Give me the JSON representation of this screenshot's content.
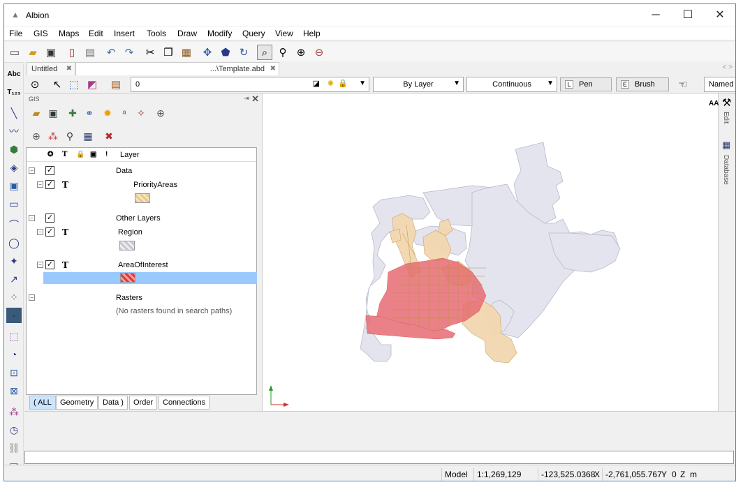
{
  "app": {
    "title": "Albion"
  },
  "window": {
    "minimize": "─",
    "maximize": "☐",
    "close": "✕"
  },
  "menu": [
    "File",
    "GIS",
    "Maps",
    "Edit",
    "Insert",
    "Tools",
    "Draw",
    "Modify",
    "Query",
    "View",
    "Help"
  ],
  "doc_tabs": [
    {
      "label": "Untitled"
    },
    {
      "label": "...\\Template.abd"
    }
  ],
  "tab_close": "✖",
  "tab_nav": "< >",
  "props": {
    "layer_value": "0",
    "linetype_color": "By Layer",
    "linetype": "Continuous",
    "pen_key": "L",
    "pen_label": "Pen",
    "brush_key": "E",
    "brush_label": "Brush",
    "named_style": "Named S"
  },
  "panel": {
    "title": "GIS",
    "pin": "⇥",
    "close": "✕"
  },
  "layer_header": {
    "c1": "✪",
    "c2": "T",
    "c3": "🔒",
    "c4": "▣",
    "c5": "!",
    "layer": "Layer"
  },
  "layers": {
    "data": "Data",
    "priority": "PriorityAreas",
    "other": "Other Layers",
    "region": "Region",
    "aoi": "AreaOfInterest",
    "rasters": "Rasters",
    "no_rasters": "(No rasters found in search paths)",
    "t": "T",
    "check": "✓",
    "minus": "−"
  },
  "bottom_tabs": [
    "( ALL",
    "Geometry",
    "Data )",
    "Order",
    "Connections"
  ],
  "right_dock": {
    "font_icon": "AA",
    "edit": "Edit",
    "database": "Database"
  },
  "status": {
    "model": "Model",
    "scale": "1:1,269,129",
    "x": "-123,525.0368",
    "x_label": "X",
    "y": "-2,761,055.767",
    "y_label": "Y",
    "z": "0",
    "z_label": "Z",
    "unit": "m"
  },
  "colors": {
    "selection": "#99c9ff",
    "region_fill": "#e4e4ee",
    "priority_fill": "#e8b9a0",
    "aoi_fill": "#e86c74"
  }
}
